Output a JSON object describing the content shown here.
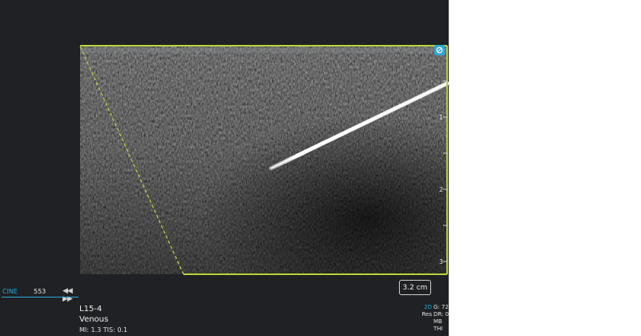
{
  "cine": {
    "label": "CINE",
    "frame": "553",
    "controls": "◀◀ ▶▶"
  },
  "probe": {
    "model": "L15-4",
    "preset": "Venous",
    "indices": "MI: 1.3  TIS: 0.1"
  },
  "scale": {
    "badge": "3.2 cm",
    "depth_marks": [
      "1",
      "2",
      "3"
    ]
  },
  "params": {
    "rows": [
      {
        "left": "2D",
        "right": "G: 72"
      },
      {
        "left": "Res",
        "right": "DR: 0"
      },
      {
        "left": "",
        "right": "MB"
      },
      {
        "left": "",
        "right": "THI"
      }
    ]
  },
  "colors": {
    "accent": "#2da7d6",
    "roi": "#b8d23a",
    "background": "#1f2124"
  },
  "icons": {
    "orientation": "orientation-marker-icon",
    "replay": "cine-controls-icon"
  }
}
